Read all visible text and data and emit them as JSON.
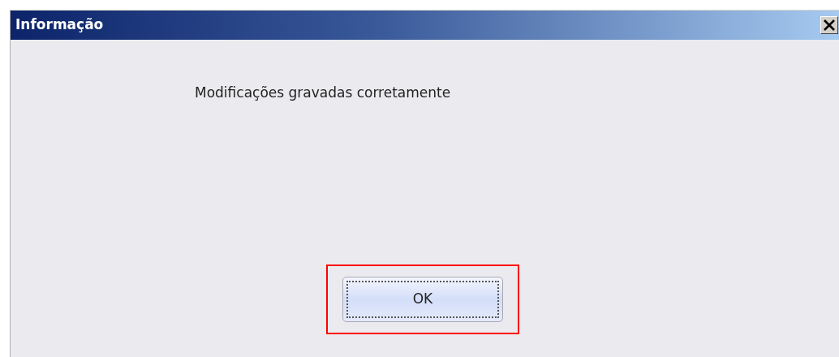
{
  "window": {
    "title": "Informação"
  },
  "message": "Modificações gravadas corretamente",
  "button": {
    "label": "OK",
    "focused": true,
    "highlighted": true
  }
}
